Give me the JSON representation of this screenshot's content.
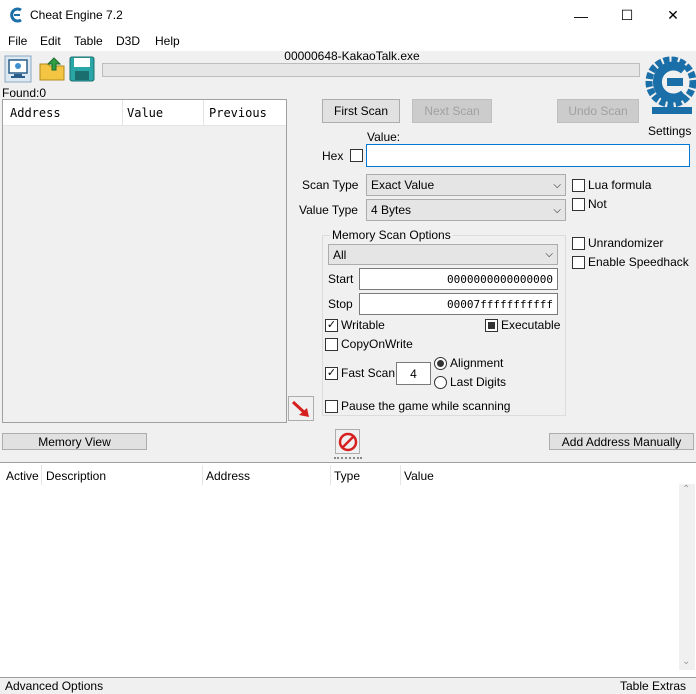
{
  "window": {
    "title": "Cheat Engine 7.2",
    "controls": {
      "minimize": "—",
      "maximize": "☐",
      "close": "✕"
    }
  },
  "menu": [
    "File",
    "Edit",
    "Table",
    "D3D",
    "Help"
  ],
  "toolbar": {
    "process_title": "00000648-KakaoTalk.exe",
    "progress": 0,
    "icons": [
      "open-process-icon",
      "open-file-icon",
      "save-icon"
    ]
  },
  "logo": {
    "settings_label": "Settings",
    "brand": "Cheat Engine"
  },
  "found": "Found:0",
  "scan_list": {
    "columns": [
      "Address",
      "Value",
      "Previous"
    ]
  },
  "scan_buttons": {
    "first_scan": "First Scan",
    "next_scan": "Next Scan",
    "undo_scan": "Undo Scan"
  },
  "value": {
    "label": "Value:",
    "hex_label": "Hex",
    "hex_checked": false,
    "input_value": ""
  },
  "scan_type": {
    "label": "Scan Type",
    "selected": "Exact Value"
  },
  "value_type": {
    "label": "Value Type",
    "selected": "4 Bytes"
  },
  "options_right": {
    "lua_formula": {
      "label": "Lua formula",
      "checked": false
    },
    "not": {
      "label": "Not",
      "checked": false
    },
    "unrandomizer": {
      "label": "Unrandomizer",
      "checked": false
    },
    "speedhack": {
      "label": "Enable Speedhack",
      "checked": false
    }
  },
  "memory_scan": {
    "title": "Memory Scan Options",
    "region": "All",
    "start_label": "Start",
    "start_value": "0000000000000000",
    "stop_label": "Stop",
    "stop_value": "00007fffffffffff",
    "writable": {
      "label": "Writable",
      "checked": true
    },
    "executable": {
      "label": "Executable",
      "state": "indeterminate"
    },
    "copy_on_write": {
      "label": "CopyOnWrite",
      "checked": false
    },
    "fast_scan": {
      "label": "Fast Scan",
      "checked": true,
      "value": "4"
    },
    "alignment": {
      "label": "Alignment",
      "selected": true
    },
    "last_digits": {
      "label": "Last Digits",
      "selected": false
    },
    "pause": {
      "label": "Pause the game while scanning",
      "checked": false
    }
  },
  "bottom_buttons": {
    "memory_view": "Memory View",
    "add_address": "Add Address Manually"
  },
  "address_list": {
    "columns": [
      "Active",
      "Description",
      "Address",
      "Type",
      "Value"
    ]
  },
  "status": {
    "left": "Advanced Options",
    "right": "Table Extras"
  },
  "colors": {
    "accent_blue": "#0078d7",
    "logo_blue": "#1b6fa8",
    "arrow_red": "#d62020"
  }
}
